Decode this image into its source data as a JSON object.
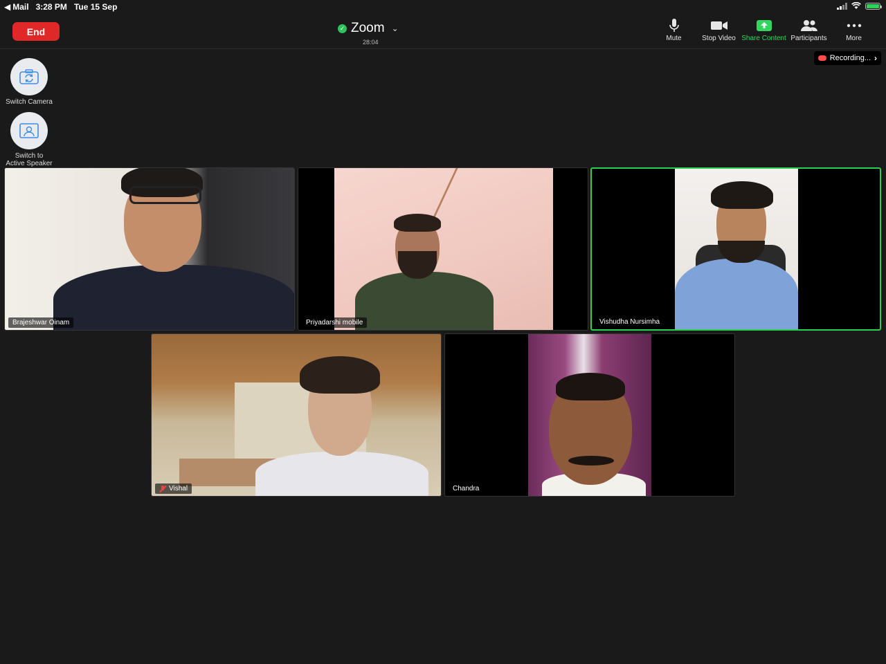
{
  "status_bar": {
    "back_app": "Mail",
    "time": "3:28 PM",
    "date": "Tue 15 Sep"
  },
  "toolbar": {
    "end_label": "End",
    "title": "Zoom",
    "timer": "28:04",
    "tools": [
      {
        "label": "Mute",
        "icon": "microphone-icon"
      },
      {
        "label": "Stop Video",
        "icon": "video-camera-icon"
      },
      {
        "label": "Share Content",
        "icon": "share-screen-icon"
      },
      {
        "label": "Participants",
        "icon": "participants-icon"
      },
      {
        "label": "More",
        "icon": "more-dots-icon"
      }
    ],
    "accent_color": "#32d65f",
    "end_color": "#e02828"
  },
  "recording": {
    "label": "Recording..."
  },
  "side_buttons": {
    "switch_camera": "Switch Camera",
    "switch_speaker": "Switch to Active Speaker"
  },
  "participants": [
    {
      "name": "Brajeshwar Oinam",
      "muted": false,
      "active": false
    },
    {
      "name": "Priyadarshi mobile",
      "muted": false,
      "active": false
    },
    {
      "name": "Vishudha Nursimha",
      "muted": false,
      "active": true
    },
    {
      "name": "Vishal",
      "muted": true,
      "active": false
    },
    {
      "name": "Chandra",
      "muted": false,
      "active": false
    }
  ]
}
